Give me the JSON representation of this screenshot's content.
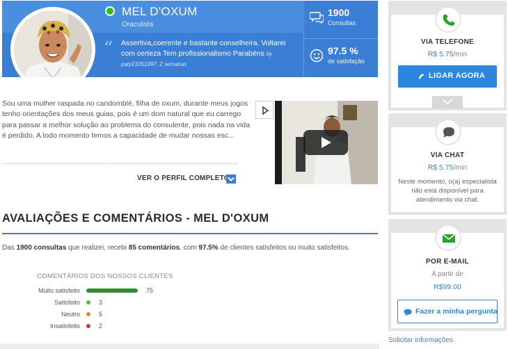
{
  "profile": {
    "name": "MEL D'OXUM",
    "role": "Oraculista",
    "status_color": "#1fc51f",
    "quote": {
      "text": "Assertiva,coerente e bastante conselheira. Voltarei com certeza Tem profissionalismo Parabéns",
      "author": "by paty21051997, 2 semanas"
    },
    "stats": {
      "consultations": {
        "value": "1900",
        "label": "Consultas",
        "icon": "chat-bubbles-icon"
      },
      "satisfaction": {
        "value": "97.5 %",
        "label": "de satisfação",
        "icon": "smiley-icon"
      }
    }
  },
  "bio": {
    "text": "Sou uma mulher raspada no candomblé, filha de oxum, durante meus jogos tenho orientações dos meus guias, pois é um dom natural que eu carrego para passar a melhor solução ao problema do consulente, pois nada na vida é perdido. A todo momento temos a capacidade de mudar nossas esc...",
    "view_profile_label": "VER O PERFIL COMPLETO"
  },
  "reviews": {
    "title": "AVALIAÇÕES E COMENTÁRIOS - MEL D'OXUM",
    "summary": {
      "p1": "Das ",
      "consultations": "1900 consultas",
      "p2": " que realizei, recebi ",
      "comments": "85 comentários",
      "p3": ", com ",
      "percent": "97.5%",
      "p4": " de clientes satisfeitos ou muito satisfeitos."
    },
    "comments_title": "COMENTÁRIOS DOS NOSSOS CLIENTES",
    "ratings": [
      {
        "label": "Muito satisfeito",
        "count": "75",
        "value": 75,
        "color": "#2e8b2e"
      },
      {
        "label": "Satisfeito",
        "count": "3",
        "value": 3,
        "color": "#54b84a"
      },
      {
        "label": "Neutro",
        "count": "5",
        "value": 5,
        "color": "#e8852b"
      },
      {
        "label": "Insatisfeito",
        "count": "2",
        "value": 2,
        "color": "#d9332b"
      }
    ]
  },
  "contact": {
    "phone": {
      "title": "VIA TELEFONE",
      "price": "R$ 5.75",
      "unit": "/min",
      "button": "LIGAR AGORA",
      "icon": "phone-icon"
    },
    "chat": {
      "title": "VIA CHAT",
      "price": "R$ 5.75",
      "unit": "/min",
      "note": "Neste momento, o(a) especialista não está disponível para atendimento via chat.",
      "icon": "chat-icon"
    },
    "email": {
      "title": "POR E-MAIL",
      "prefix": "A partir de",
      "price": "R$99.00",
      "button": "Fazer a minha pergunta",
      "icon": "email-icon"
    },
    "info_link": "Solicitar informações"
  },
  "colors": {
    "brand": "#3a7fd5",
    "green": "#1fc51f"
  }
}
